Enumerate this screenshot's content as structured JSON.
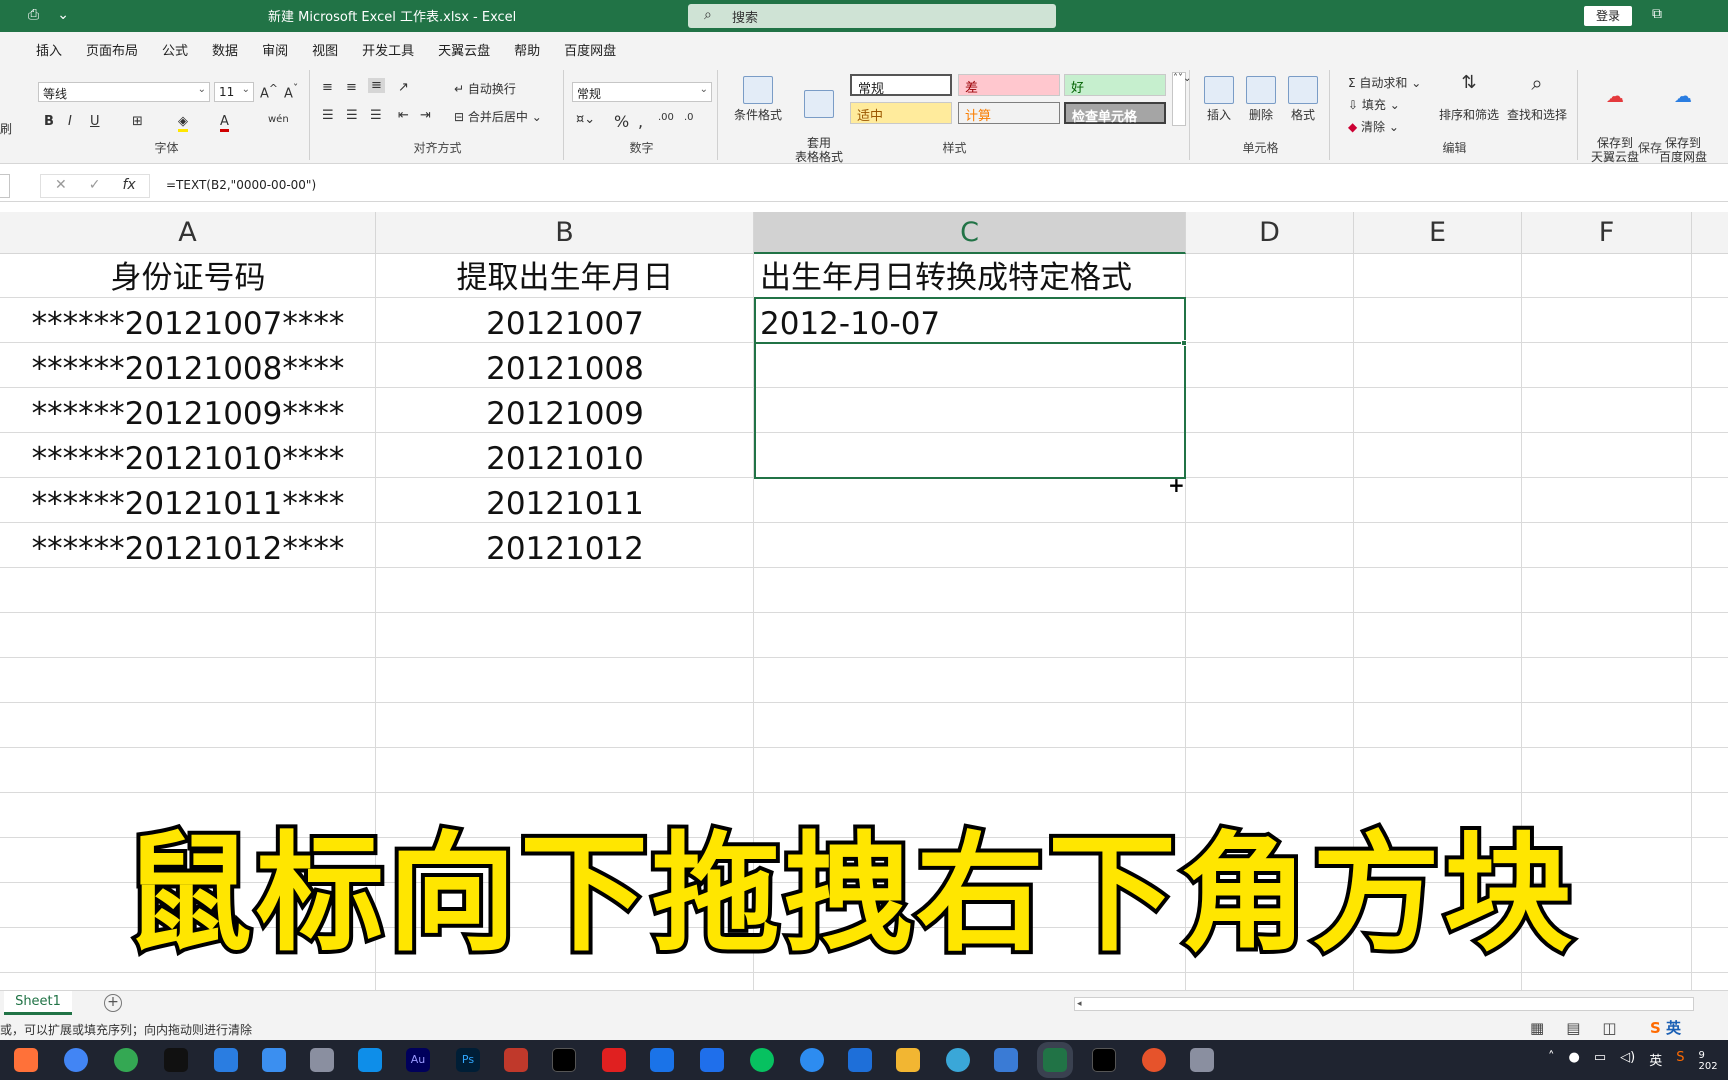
{
  "titlebar": {
    "title": "新建 Microsoft Excel 工作表.xlsx  -  Excel",
    "search_placeholder": "搜索",
    "login_label": "登录"
  },
  "tabs": [
    "插入",
    "页面布局",
    "公式",
    "数据",
    "审阅",
    "视图",
    "开发工具",
    "天翼云盘",
    "帮助",
    "百度网盘"
  ],
  "ribbon": {
    "font_name": "等线",
    "font_size": "11",
    "font_group_label": "字体",
    "wrap_text_label": "自动换行",
    "merge_label": "合并后居中",
    "align_group_label": "对齐方式",
    "number_format": "常规",
    "number_group_label": "数字",
    "cond_format_label": "条件格式",
    "table_format_label": "套用\n表格格式",
    "styles": {
      "normal": "常规",
      "bad": "差",
      "good": "好",
      "neutral": "适中",
      "calc": "计算",
      "check": "检查单元格"
    },
    "styles_group_label": "样式",
    "insert_label": "插入",
    "delete_label": "删除",
    "format_label": "格式",
    "cells_group_label": "单元格",
    "autosum_label": "自动求和",
    "fill_label": "填充",
    "clear_label": "清除",
    "sort_filter_label": "排序和筛选",
    "find_select_label": "查找和选择",
    "edit_group_label": "编辑",
    "save_tianyi_label": "保存到\n天翼云盘",
    "save_baidu_label": "保存到\n百度网盘",
    "save_group_label": "保存",
    "clipboard_fragment": "刷"
  },
  "formula_bar": {
    "fx": "fx",
    "formula": "=TEXT(B2,\"0000-00-00\")"
  },
  "columns": [
    "A",
    "B",
    "C",
    "D",
    "E",
    "F"
  ],
  "sheet": {
    "header_row": [
      "身份证号码",
      "提取出生年月日",
      "出生年月日转换成特定格式"
    ],
    "rows": [
      {
        "a": "******20121007****",
        "b": "20121007",
        "c": "2012-10-07"
      },
      {
        "a": "******20121008****",
        "b": "20121008",
        "c": ""
      },
      {
        "a": "******20121009****",
        "b": "20121009",
        "c": ""
      },
      {
        "a": "******20121010****",
        "b": "20121010",
        "c": ""
      },
      {
        "a": "******20121011****",
        "b": "20121011",
        "c": ""
      },
      {
        "a": "******20121012****",
        "b": "20121012",
        "c": ""
      }
    ]
  },
  "caption": "鼠标向下拖拽右下角方块",
  "sheet_tab": "Sheet1",
  "status_text": "或，可以扩展或填充序列；向内拖动则进行清除",
  "ime_label": "英",
  "tray_time": "9",
  "tray_year": "202",
  "colors": {
    "excel_green": "#217346",
    "caption_fill": "#ffe600",
    "caption_stroke": "#000000",
    "taskbar": "#1f2430"
  }
}
